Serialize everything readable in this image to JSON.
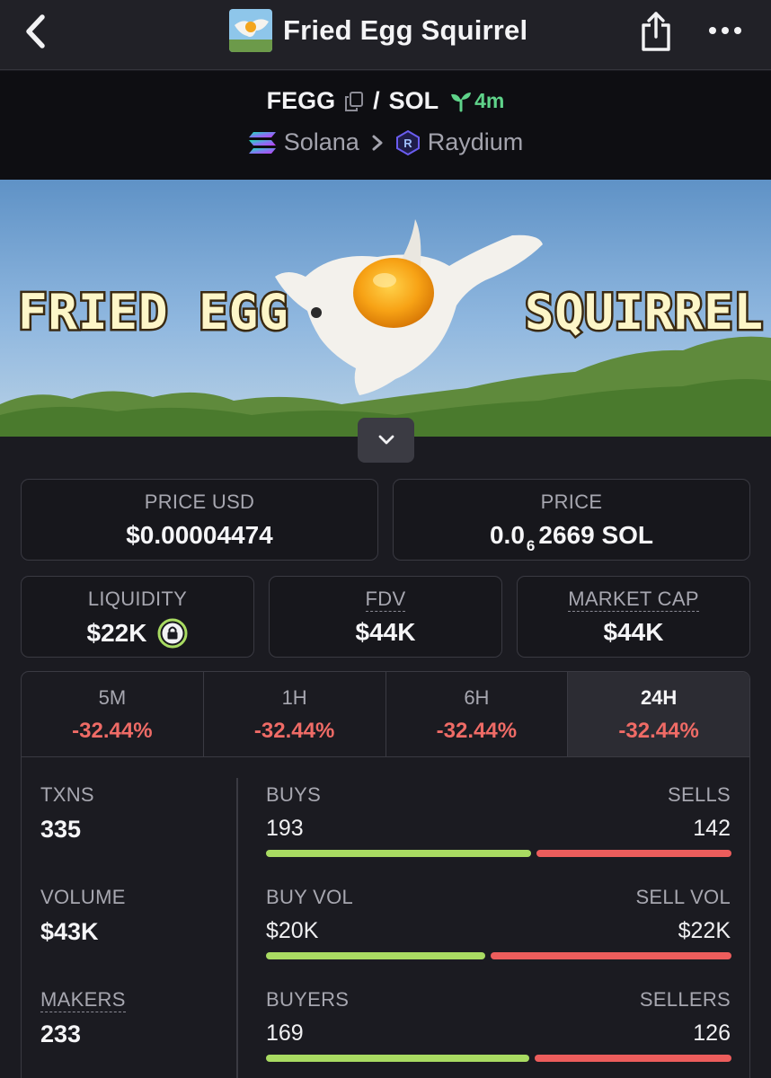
{
  "header": {
    "title": "Fried Egg Squirrel",
    "icons": {
      "back": "chevron-left-icon",
      "share": "share-icon",
      "more": "more-horizontal-icon"
    }
  },
  "pair": {
    "base": "FEGG",
    "separator": "/",
    "quote": "SOL",
    "age": "4m",
    "chain": "Solana",
    "dex": "Raydium"
  },
  "banner": {
    "left_text": "FRIED EGG",
    "right_text": "SQUIRREL"
  },
  "stats_cards": {
    "price_usd_label": "PRICE USD",
    "price_usd": "$0.00004474",
    "price_label": "PRICE",
    "price_prefix": "0.0",
    "price_zeros": "6",
    "price_suffix": "2669 SOL",
    "liquidity_label": "LIQUIDITY",
    "liquidity": "$22K",
    "fdv_label": "FDV",
    "fdv": "$44K",
    "mcap_label": "MARKET CAP",
    "mcap": "$44K"
  },
  "timeframes": [
    {
      "label": "5M",
      "change": "-32.44%"
    },
    {
      "label": "1H",
      "change": "-32.44%"
    },
    {
      "label": "6H",
      "change": "-32.44%"
    },
    {
      "label": "24H",
      "change": "-32.44%",
      "active": true
    }
  ],
  "txn_stats": {
    "txns_label": "TXNS",
    "txns": "335",
    "volume_label": "VOLUME",
    "volume": "$43K",
    "makers_label": "MAKERS",
    "makers": "233",
    "buys_label": "BUYS",
    "buys": "193",
    "sells_label": "SELLS",
    "sells": "142",
    "buy_vol_label": "BUY VOL",
    "buy_vol": "$20K",
    "sell_vol_label": "SELL VOL",
    "sell_vol": "$22K",
    "buyers_label": "BUYERS",
    "buyers": "169",
    "sellers_label": "SELLERS",
    "sellers": "126"
  },
  "ratios": {
    "buys_sells": 0.576,
    "buyvol_sellvol": 0.476,
    "buyers_sellers": 0.573
  },
  "colors": {
    "buy": "#a9db62",
    "sell": "#ec5d5c",
    "negative": "#ef6b66",
    "age": "#5fd38a"
  }
}
